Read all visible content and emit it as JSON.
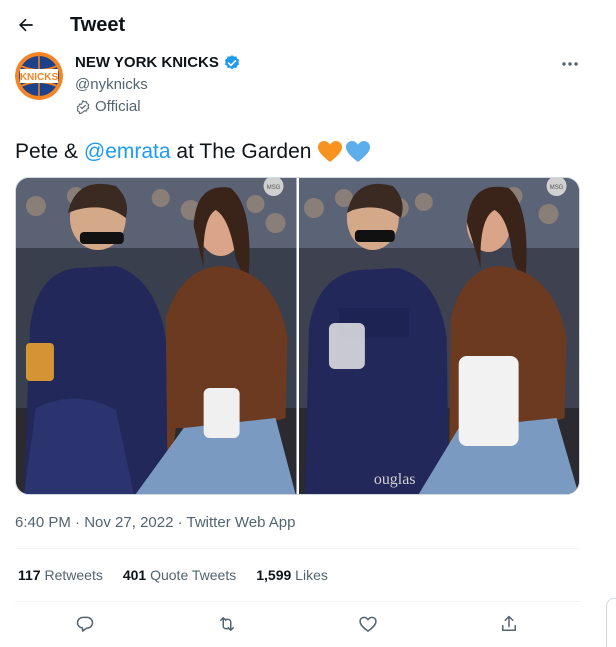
{
  "header": {
    "title": "Tweet",
    "back_icon": "arrow-left-icon"
  },
  "author": {
    "display_name": "NEW YORK KNICKS",
    "handle": "@nyknicks",
    "official_label": "Official",
    "avatar_text": "KNICKS",
    "avatar_colors": {
      "blue": "#1d428a",
      "orange": "#f58426"
    },
    "verified_color": "#1d9bf0"
  },
  "tweet": {
    "text_before": "Pete & ",
    "mention": "@emrata",
    "text_after": " at The Garden",
    "hearts": [
      "orange-heart-icon",
      "blue-heart-icon"
    ],
    "heart_colors": [
      "#f7931e",
      "#5dadec"
    ]
  },
  "media": {
    "count": 2,
    "photo_1_watermark": "MSG",
    "photo_2_watermark": "MSG",
    "photo_2_caption": "ouglas"
  },
  "meta": {
    "time": "6:40 PM",
    "sep": " · ",
    "date": "Nov 27, 2022",
    "source": "Twitter Web App"
  },
  "stats": [
    {
      "count": "117",
      "label": "Retweets"
    },
    {
      "count": "401",
      "label": "Quote Tweets"
    },
    {
      "count": "1,599",
      "label": "Likes"
    }
  ],
  "actions": [
    "reply-icon",
    "retweet-icon",
    "like-icon",
    "share-icon"
  ]
}
